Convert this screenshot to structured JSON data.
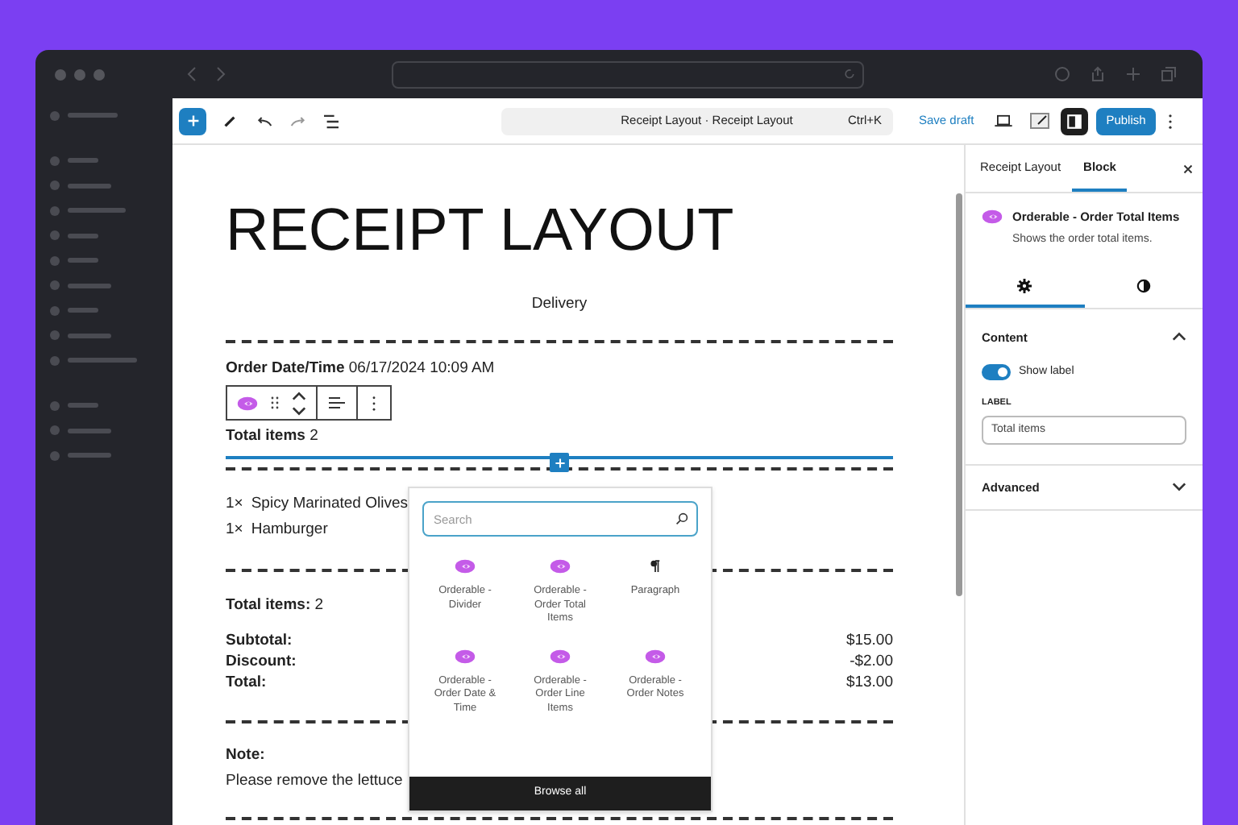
{
  "toolbar": {
    "document_title": "Receipt Layout · Receipt Layout",
    "shortcut": "Ctrl+K",
    "save_draft": "Save draft",
    "settings_toggle": {
      "selected": true
    },
    "publish": "Publish"
  },
  "receipt": {
    "title": "RECEIPT LAYOUT",
    "subtitle": "Delivery",
    "order_date": {
      "label": "Order Date/Time",
      "value": "06/17/2024 10:09 AM"
    },
    "selected_block": {
      "label": "Total items",
      "value": "2"
    },
    "line_items": [
      {
        "qty": "1×",
        "name": "Spicy Marinated Olives"
      },
      {
        "qty": "1×",
        "name": "Hamburger"
      }
    ],
    "item_count": {
      "label": "Total items:",
      "value": "2"
    },
    "amounts": [
      {
        "label": "Subtotal:",
        "value": "$15.00"
      },
      {
        "label": "Discount:",
        "value": "-$2.00"
      },
      {
        "label": "Total:",
        "value": "$13.00"
      }
    ],
    "note": {
      "label": "Note:",
      "text": "Please remove the lettuce"
    }
  },
  "inserter": {
    "placeholder": "Search",
    "blocks": [
      {
        "kind": "orderable",
        "label": "Orderable - Divider"
      },
      {
        "kind": "orderable",
        "label": "Orderable - Order Total Items"
      },
      {
        "kind": "paragraph",
        "label": "Paragraph"
      },
      {
        "kind": "orderable",
        "label": "Orderable - Order Date & Time"
      },
      {
        "kind": "orderable",
        "label": "Orderable - Order Line Items"
      },
      {
        "kind": "orderable",
        "label": "Orderable - Order Notes"
      }
    ],
    "browse_all": "Browse all"
  },
  "panel": {
    "tabs": [
      {
        "label": "Receipt Layout",
        "selected": false
      },
      {
        "label": "Block",
        "selected": true
      }
    ],
    "block": {
      "title": "Orderable - Order Total Items",
      "description": "Shows the order total items."
    },
    "subtabs": [
      {
        "kind": "settings",
        "selected": true
      },
      {
        "kind": "styles",
        "selected": false
      }
    ],
    "content": {
      "title": "Content",
      "expanded": true,
      "toggle": {
        "label": "Show label",
        "on": true
      },
      "field": {
        "label": "LABEL",
        "value": "Total items"
      }
    },
    "advanced": {
      "title": "Advanced",
      "expanded": false
    }
  }
}
